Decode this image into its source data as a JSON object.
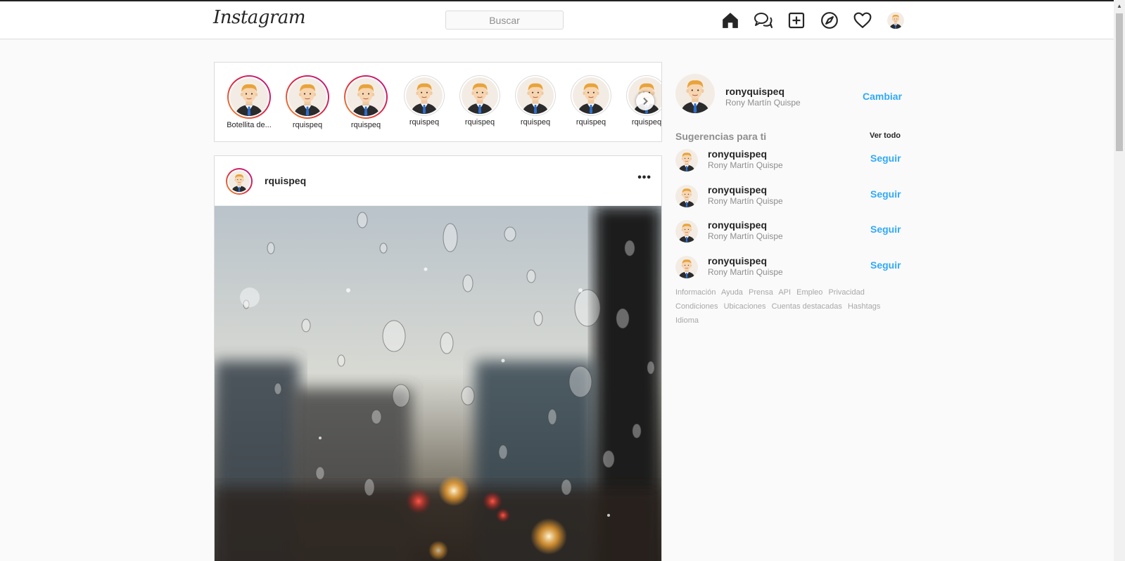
{
  "header": {
    "logo_text": "Instagram",
    "search_placeholder": "Buscar",
    "icons": [
      "home-icon",
      "direct-messages-icon",
      "new-post-icon",
      "explore-icon",
      "activity-heart-icon",
      "profile-avatar"
    ]
  },
  "stories": {
    "items": [
      {
        "label": "Botellita de...",
        "seen": false
      },
      {
        "label": "rquispeq",
        "seen": false
      },
      {
        "label": "rquispeq",
        "seen": false
      },
      {
        "label": "rquispeq",
        "seen": true
      },
      {
        "label": "rquispeq",
        "seen": true
      },
      {
        "label": "rquispeq",
        "seen": true
      },
      {
        "label": "rquispeq",
        "seen": true
      },
      {
        "label": "rquispeq",
        "seen": true
      }
    ],
    "next_icon": "chevron-right-icon"
  },
  "post": {
    "username": "rquispeq",
    "more_label": "•••"
  },
  "sidebar": {
    "username": "ronyquispeq",
    "fullname": "Rony Martín Quispe",
    "switch_label": "Cambiar",
    "suggestions_title": "Sugerencias para ti",
    "see_all_label": "Ver todo",
    "suggestions": [
      {
        "username": "ronyquispeq",
        "fullname": "Rony Martín Quispe",
        "action": "Seguir"
      },
      {
        "username": "ronyquispeq",
        "fullname": "Rony Martín Quispe",
        "action": "Seguir"
      },
      {
        "username": "ronyquispeq",
        "fullname": "Rony Martín Quispe",
        "action": "Seguir"
      },
      {
        "username": "ronyquispeq",
        "fullname": "Rony Martín Quispe",
        "action": "Seguir"
      }
    ],
    "footer_links": [
      "Información",
      "Ayuda",
      "Prensa",
      "API",
      "Empleo",
      "Privacidad",
      "Condiciones",
      "Ubicaciones",
      "Cuentas destacadas",
      "Hashtags",
      "Idioma"
    ]
  },
  "colors": {
    "link_blue": "#0095f6",
    "border": "#dbdbdb",
    "muted_text": "#8e8e8e"
  }
}
